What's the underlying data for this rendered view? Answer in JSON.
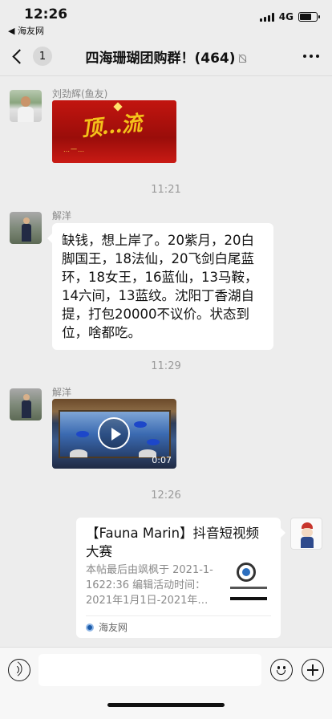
{
  "status_bar": {
    "time": "12:26",
    "back_app": "◀ 海友网",
    "network": "4G",
    "battery_level": 0.7
  },
  "nav": {
    "unread_count": "1",
    "title": "四海珊瑚团购群！(464)"
  },
  "messages": [
    {
      "sender": "刘劲辉(鱼友)",
      "type": "sticker",
      "sticker_text": "顶…流",
      "sticker_subtext": "…一…"
    },
    {
      "time_separator": "11:21",
      "sender": "解洋",
      "type": "text",
      "text": "缺钱，想上岸了。20紫月，20白脚国王，18法仙，20飞剑白尾蓝环，18女王，16蓝仙，13马鞍，14六间，13蓝纹。沈阳丁香湖自提，打包20000不议价。状态到位，啥都吃。"
    },
    {
      "time_separator": "11:29",
      "sender": "解洋",
      "type": "video",
      "duration": "0:07"
    },
    {
      "time_separator": "12:26",
      "sender": "self",
      "type": "link",
      "title": "【Fauna Marin】抖音短视频大赛",
      "description": "本帖最后由飒枫于 2021-1-1622:36 编辑活动时间：2021年1月1日-2021年…",
      "source": "海友网"
    }
  ],
  "input_bar": {
    "placeholder": ""
  }
}
